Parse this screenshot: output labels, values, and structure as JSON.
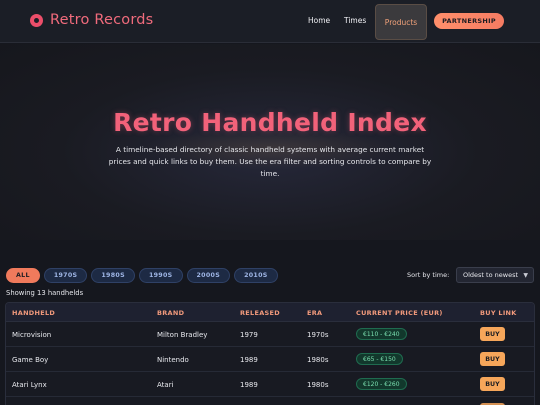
{
  "nav": {
    "brand": "Retro Records",
    "links": [
      "Home",
      "Times",
      "Products"
    ],
    "partnership": "PARTNERSHIP"
  },
  "hero": {
    "title": "Retro Handheld Index",
    "description": "A timeline-based directory of classic handheld systems with average current market prices and quick links to buy them. Use the era filter and sorting controls to compare by time."
  },
  "filters": {
    "eras": [
      "ALL",
      "1970S",
      "1980S",
      "1990S",
      "2000S",
      "2010S"
    ],
    "active": "ALL",
    "sort_label": "Sort by time:",
    "sort_value": "Oldest to newest"
  },
  "count_text": "Showing 13 handhelds",
  "table": {
    "headers": [
      "HANDHELD",
      "BRAND",
      "RELEASED",
      "ERA",
      "CURRENT PRICE (EUR)",
      "BUY LINK"
    ],
    "rows": [
      {
        "handheld": "Microvision",
        "brand": "Milton Bradley",
        "released": "1979",
        "era": "1970s",
        "price": "€110 - €240",
        "buy": "BUY"
      },
      {
        "handheld": "Game Boy",
        "brand": "Nintendo",
        "released": "1989",
        "era": "1980s",
        "price": "€65 - €150",
        "buy": "BUY"
      },
      {
        "handheld": "Atari Lynx",
        "brand": "Atari",
        "released": "1989",
        "era": "1980s",
        "price": "€120 - €260",
        "buy": "BUY"
      },
      {
        "handheld": "",
        "brand": "",
        "released": "",
        "era": "",
        "price": "",
        "buy": ""
      }
    ]
  },
  "colors": {
    "accent": "#f2627a",
    "orange": "#f07a5c",
    "buy": "#f6a65a",
    "price_green": "#7be0b0"
  }
}
